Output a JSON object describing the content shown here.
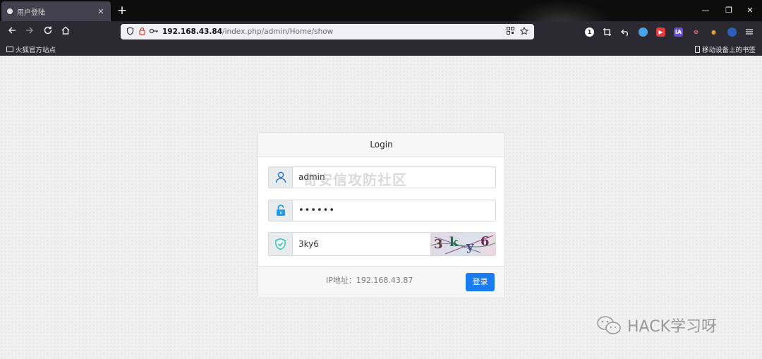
{
  "window": {
    "tab_title": "用户登陆",
    "tab_close": "✕",
    "new_tab": "+",
    "minimize": "—",
    "restore": "❐",
    "close": "✕"
  },
  "nav": {
    "url_host": "192.168.43.84",
    "url_path": "/index.php/admin/Home/show"
  },
  "bookmarks": {
    "left_label": "火狐官方站点",
    "right_label": "移动设备上的书签"
  },
  "extensions": [
    {
      "label": "1",
      "color": "#ffffff"
    },
    {
      "label": "IA",
      "color": "#6a4bd8"
    }
  ],
  "login": {
    "title": "Login",
    "username": "admin",
    "password_mask": "••••••",
    "captcha_value": "3ky6",
    "captcha_chars": [
      "3",
      "k",
      "y",
      "6"
    ],
    "ip_label": "IP地址：192.168.43.87",
    "submit_label": "登录"
  },
  "watermarks": {
    "center": "奇安信攻防社区",
    "corner": "HACK学习呀"
  },
  "colors": {
    "accent": "#1a7cf0",
    "shield": "#3dbfb0",
    "user_icon": "#2f7bd6",
    "lock_icon": "#1e9bf0"
  }
}
